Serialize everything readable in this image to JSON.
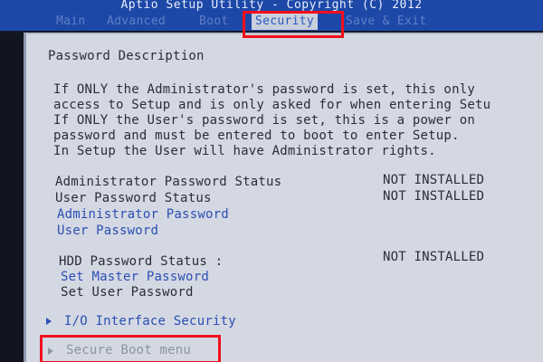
{
  "title": "Aptio Setup Utility - Copyright (C) 2012",
  "tabs": [
    {
      "label": "Main"
    },
    {
      "label": "Advanced"
    },
    {
      "label": "Boot"
    },
    {
      "label": "Security"
    },
    {
      "label": "Save & Exit"
    }
  ],
  "active_tab": "Security",
  "section_title": "Password Description",
  "description": [
    "If ONLY the Administrator's password is set, this only",
    "access to Setup and is only asked for when entering Setu",
    "If ONLY the User's password is set, this is a power on",
    "password and must be entered to boot to enter Setup.",
    "In Setup the User will have Administrator rights."
  ],
  "status": {
    "admin_label": "Administrator Password Status",
    "admin_value": "NOT INSTALLED",
    "user_label": "User Password Status",
    "user_value": "NOT INSTALLED",
    "hdd_label": "HDD Password Status  :",
    "hdd_value": "NOT INSTALLED"
  },
  "items": {
    "admin_password": "Administrator Password",
    "user_password": "User Password",
    "set_master_password": "Set Master Password",
    "set_user_password": "Set User Password",
    "io_interface_security": "I/O Interface Security",
    "secure_boot_menu": "Secure Boot menu"
  },
  "colors": {
    "bios_blue": "#1d48a8",
    "panel_gray": "#d4d8e2",
    "link_blue": "#2b4fb5",
    "highlight_red": "#f20f1c"
  }
}
